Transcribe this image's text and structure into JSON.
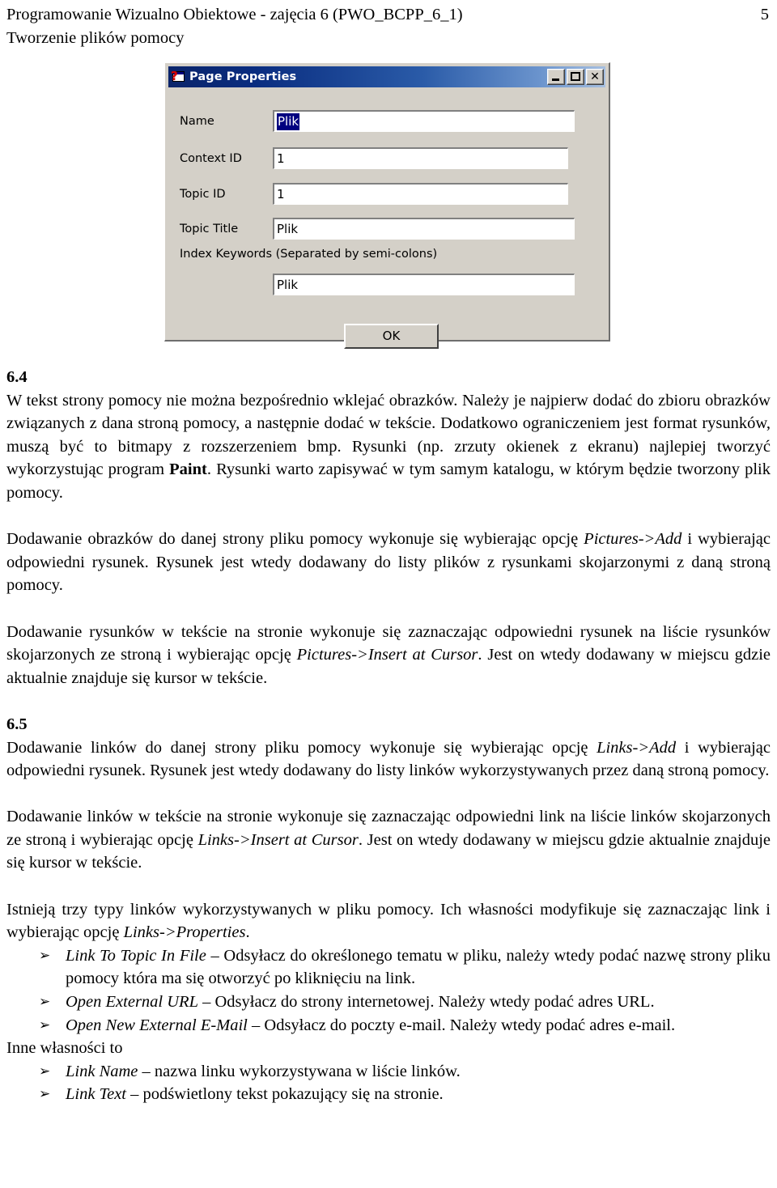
{
  "header": {
    "title": "Programowanie Wizualno Obiektowe - zajęcia 6 (PWO_BCPP_6_1)",
    "subtitle": "Tworzenie plików pomocy",
    "page_number": "5"
  },
  "dialog": {
    "title": "Page Properties",
    "icon": "help-question-window-icon",
    "buttons": {
      "minimize": "_",
      "maximize": "□",
      "close": "✕"
    },
    "fields": [
      {
        "label": "Name",
        "value": "Plik",
        "selected": true
      },
      {
        "label": "Context ID",
        "value": "1",
        "selected": false
      },
      {
        "label": "Topic ID",
        "value": "1",
        "selected": false
      },
      {
        "label": "Topic Title",
        "value": "Plik",
        "selected": false
      }
    ],
    "keywords_label": "Index Keywords (Separated by semi-colons)",
    "keywords_value": "Plik",
    "ok_label": "OK",
    "colors": {
      "face": "#d4d0c8",
      "titlebar_start": "#0a246a",
      "titlebar_end": "#a6bfe0",
      "selection": "#000080"
    }
  },
  "sections": {
    "s64": {
      "number": "6.4",
      "p1_a": "W tekst strony pomocy nie można bezpośrednio wklejać obrazków. Należy je najpierw dodać do zbioru obrazków związanych z dana stroną pomocy, a następnie dodać w tekście. Dodatkowo ograniczeniem jest format rysunków, muszą być to bitmapy z rozszerzeniem bmp. Rysunki (np. zrzuty okienek z ekranu) najlepiej tworzyć wykorzystując program ",
      "p1_bold": "Paint",
      "p1_b": ". Rysunki warto zapisywać w tym samym katalogu, w którym będzie tworzony plik pomocy.",
      "p2_a": "Dodawanie obrazków do danej strony pliku pomocy wykonuje się wybierając opcję ",
      "p2_ital": "Pictures->Add",
      "p2_b": " i wybierając odpowiedni rysunek. Rysunek jest wtedy dodawany do listy plików z rysunkami skojarzonymi z daną stroną pomocy.",
      "p3_a": "Dodawanie rysunków w tekście na stronie wykonuje się zaznaczając odpowiedni rysunek na liście rysunków skojarzonych ze stroną i wybierając opcję ",
      "p3_ital": "Pictures->Insert at Cursor",
      "p3_b": ". Jest on wtedy dodawany w miejscu gdzie aktualnie znajduje się kursor w tekście."
    },
    "s65": {
      "number": "6.5",
      "p1_a": "Dodawanie linków do danej strony pliku pomocy wykonuje się wybierając opcję ",
      "p1_ital": "Links->Add",
      "p1_b": " i wybierając odpowiedni rysunek. Rysunek jest wtedy dodawany do listy linków wykorzystywanych przez daną stroną pomocy.",
      "p2_a": "Dodawanie linków w tekście na stronie wykonuje się zaznaczając odpowiedni link na liście linków skojarzonych ze stroną i wybierając opcję ",
      "p2_ital": "Links->Insert at Cursor",
      "p2_b": ". Jest on wtedy dodawany w miejscu gdzie aktualnie znajduje się kursor w tekście.",
      "p3_a": "Istnieją trzy typy linków wykorzystywanych w pliku pomocy. Ich własności modyfikuje się zaznaczając link i wybierając opcję ",
      "p3_ital": "Links->Properties",
      "p3_b": ".",
      "link_types": [
        {
          "marker": "➢",
          "term": "Link To Topic In File",
          "desc": " – Odsyłacz do określonego tematu w pliku, należy wtedy podać nazwę strony pliku pomocy która ma się otworzyć po kliknięciu na link."
        },
        {
          "marker": "➢",
          "term": "Open External URL",
          "desc": " – Odsyłacz do strony internetowej. Należy wtedy podać adres URL."
        },
        {
          "marker": "➢",
          "term": "Open New External E-Mail",
          "desc": " – Odsyłacz do poczty e-mail. Należy wtedy podać adres e-mail."
        }
      ],
      "other_props_heading": "Inne własności to",
      "other_props": [
        {
          "marker": "➢",
          "term": "Link Name",
          "desc": " – nazwa linku wykorzystywana w liście linków."
        },
        {
          "marker": "➢",
          "term": "Link Text",
          "desc": " – podświetlony tekst pokazujący się na stronie."
        }
      ]
    }
  }
}
